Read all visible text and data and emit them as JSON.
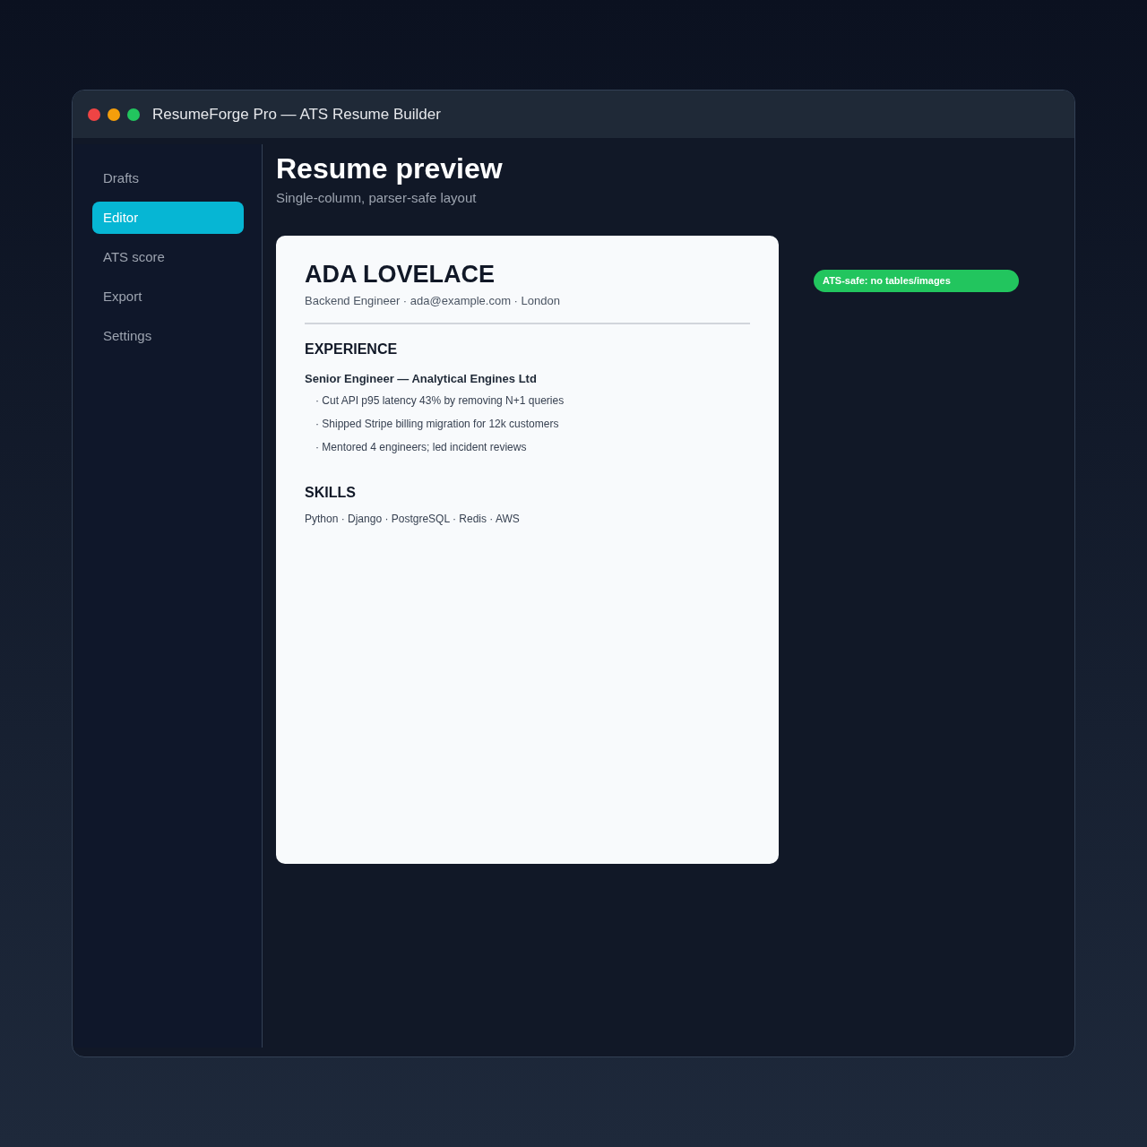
{
  "window": {
    "title": "ResumeForge Pro — ATS Resume Builder",
    "controls": [
      {
        "color": "#ef4444"
      },
      {
        "color": "#f59e0b"
      },
      {
        "color": "#22c55e"
      }
    ]
  },
  "sidebar": {
    "items": [
      {
        "label": "Drafts",
        "selected": false
      },
      {
        "label": "Editor",
        "selected": true
      },
      {
        "label": "ATS score",
        "selected": false
      },
      {
        "label": "Export",
        "selected": false
      },
      {
        "label": "Settings",
        "selected": false
      }
    ]
  },
  "main": {
    "title": "Resume preview",
    "subtitle": "Single-column, parser-safe layout"
  },
  "resume": {
    "name": "ADA LOVELACE",
    "contact": "Backend Engineer · ada@example.com · London",
    "sections": [
      {
        "kind": "experience",
        "heading": "EXPERIENCE",
        "role": "Senior Engineer — Analytical Engines Ltd",
        "bullets": [
          "· Cut API p95 latency 43% by removing N+1 queries",
          "· Shipped Stripe billing migration for 12k customers",
          "· Mentored 4 engineers; led incident reviews"
        ]
      },
      {
        "kind": "skills",
        "heading": "SKILLS",
        "text": "Python · Django · PostgreSQL · Redis · AWS"
      }
    ]
  },
  "badge": {
    "label": "ATS-safe: no tables/images"
  }
}
